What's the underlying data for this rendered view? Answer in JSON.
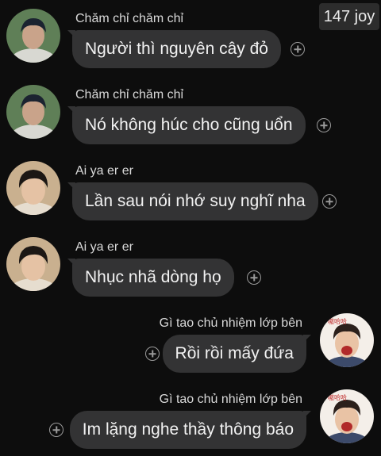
{
  "badge": {
    "text": "147 joy"
  },
  "messages": [
    {
      "sender": "Chăm chỉ chăm chỉ",
      "text": "Người thì nguyên cây đỏ",
      "side": "left",
      "avatar": "boy-avatar-1"
    },
    {
      "sender": "Chăm chỉ chăm chỉ",
      "text": "Nó không húc cho cũng uổn",
      "side": "left",
      "avatar": "boy-avatar-1"
    },
    {
      "sender": "Ai ya er er",
      "text": "Lần sau nói nhớ suy nghĩ nha",
      "side": "left",
      "avatar": "boy-avatar-2"
    },
    {
      "sender": "Ai ya er er",
      "text": "Nhục nhã dòng họ",
      "side": "left",
      "avatar": "boy-avatar-2"
    },
    {
      "sender": "Gì tao chủ nhiệm lớp bên",
      "text": "Rồi rồi mấy đứa",
      "side": "right",
      "avatar": "laughing-avatar"
    },
    {
      "sender": "Gì tao chủ nhiệm lớp bên",
      "text": "Im lặng nghe thầy thông báo",
      "side": "right",
      "avatar": "laughing-avatar"
    }
  ],
  "colors": {
    "background": "#0d0d0d",
    "bubble": "#333334",
    "name": "#d9d9d9"
  },
  "icons": {
    "add_reaction": "plus-circle-icon"
  }
}
